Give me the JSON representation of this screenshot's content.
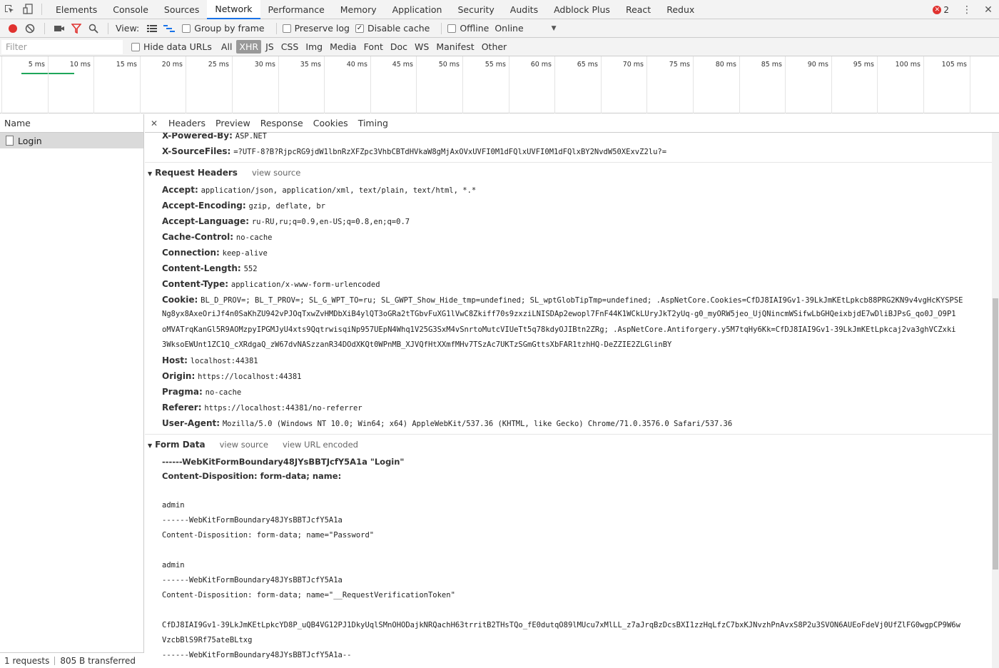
{
  "tabbar": {
    "tabs": [
      "Elements",
      "Console",
      "Sources",
      "Network",
      "Performance",
      "Memory",
      "Application",
      "Security",
      "Audits",
      "Adblock Plus",
      "React",
      "Redux"
    ],
    "active": "Network",
    "error_count": "2"
  },
  "toolbar": {
    "view_label": "View:",
    "group_by_frame": "Group by frame",
    "preserve_log": "Preserve log",
    "disable_cache": "Disable cache",
    "offline": "Offline",
    "throttle_value": "Online"
  },
  "filterbar": {
    "placeholder": "Filter",
    "hide_data_urls": "Hide data URLs",
    "types": [
      "All",
      "XHR",
      "JS",
      "CSS",
      "Img",
      "Media",
      "Font",
      "Doc",
      "WS",
      "Manifest",
      "Other"
    ],
    "active_type": "XHR"
  },
  "timeline": {
    "ticks": [
      "5 ms",
      "10 ms",
      "15 ms",
      "20 ms",
      "25 ms",
      "30 ms",
      "35 ms",
      "40 ms",
      "45 ms",
      "50 ms",
      "55 ms",
      "60 ms",
      "65 ms",
      "70 ms",
      "75 ms",
      "80 ms",
      "85 ms",
      "90 ms",
      "95 ms",
      "100 ms",
      "105 ms",
      "1"
    ]
  },
  "reqlist": {
    "header": "Name",
    "rows": [
      "Login"
    ],
    "status_requests": "1 requests",
    "status_transferred": "805 B transferred"
  },
  "detail": {
    "tabs": [
      "Headers",
      "Preview",
      "Response",
      "Cookies",
      "Timing"
    ],
    "response_tail": [
      {
        "k": "X-Powered-By:",
        "v": "ASP.NET"
      },
      {
        "k": "X-SourceFiles:",
        "v": "=?UTF-8?B?RjpcRG9jdW1lbnRzXFZpc3VhbCBTdHVkaW8gMjAxOVxUVFI0M1dFQlxUVFI0M1dFQlxBY2NvdW50XExvZ2lu?="
      }
    ],
    "request_title": "Request Headers",
    "view_source": "view source",
    "request_headers": [
      {
        "k": "Accept:",
        "v": "application/json, application/xml, text/plain, text/html, *.*"
      },
      {
        "k": "Accept-Encoding:",
        "v": "gzip, deflate, br"
      },
      {
        "k": "Accept-Language:",
        "v": "ru-RU,ru;q=0.9,en-US;q=0.8,en;q=0.7"
      },
      {
        "k": "Cache-Control:",
        "v": "no-cache"
      },
      {
        "k": "Connection:",
        "v": "keep-alive"
      },
      {
        "k": "Content-Length:",
        "v": "552"
      },
      {
        "k": "Content-Type:",
        "v": "application/x-www-form-urlencoded"
      }
    ],
    "cookie_key": "Cookie:",
    "cookie_lines": [
      "BL_D_PROV=; BL_T_PROV=; SL_G_WPT_TO=ru; SL_GWPT_Show_Hide_tmp=undefined; SL_wptGlobTipTmp=undefined; .AspNetCore.Cookies=CfDJ8IAI9Gv1-39LkJmKEtLpkcb88PRG2KN9v4vgHcKYSPSE",
      "Ng8yx8AxeOriJf4n0SaKhZU942vPJOqTxwZvHMDbXiB4ylQT3oGRa2tTGbvFuXG1lVwC8Zkiff70s9zxziLNISDAp2ewopl7FnF44K1WCkLUryJkT2yUq-g0_myORW5jeo_UjQNincmWSifwLbGHQeixbjdE7wDliBJPsG_qo0J_O9P1",
      "oMVATrqKanGl5R9AOMzpyIPGMJyU4xts9QqtrwisqiNp957UEpN4Whq1V25G3SxM4vSnrtoMutcVIUeTt5q78kdyOJIBtn2ZRg; .AspNetCore.Antiforgery.y5M7tqHy6Kk=CfDJ8IAI9Gv1-39LkJmKEtLpkcaj2va3ghVCZxki",
      "3WksoEWUnt1ZC1Q_cXRdgaQ_zW67dvNASzzanR34DOdXKQt0WPnMB_XJVQfHtXXmfMHv7TSzAc7UKTzSGmGttsXbFAR1tzhHQ-DeZZIE2ZLGlinBY"
    ],
    "request_headers_after": [
      {
        "k": "Host:",
        "v": "localhost:44381"
      },
      {
        "k": "Origin:",
        "v": "https://localhost:44381"
      },
      {
        "k": "Pragma:",
        "v": "no-cache"
      },
      {
        "k": "Referer:",
        "v": "https://localhost:44381/no-referrer"
      },
      {
        "k": "User-Agent:",
        "v": "Mozilla/5.0 (Windows NT 10.0; Win64; x64) AppleWebKit/537.36 (KHTML, like Gecko) Chrome/71.0.3576.0 Safari/537.36"
      }
    ],
    "form_title": "Form Data",
    "view_url_encoded": "view URL encoded",
    "form_lines": [
      {
        "bold": true,
        "t": "------WebKitFormBoundary48JYsBBTJcfY5A1a \"Login\""
      },
      {
        "bold": true,
        "t": "Content-Disposition: form-data; name:"
      },
      {
        "bold": false,
        "t": ""
      },
      {
        "bold": false,
        "t": "admin"
      },
      {
        "bold": false,
        "t": "------WebKitFormBoundary48JYsBBTJcfY5A1a"
      },
      {
        "bold": false,
        "t": "Content-Disposition: form-data; name=\"Password\""
      },
      {
        "bold": false,
        "t": ""
      },
      {
        "bold": false,
        "t": "admin"
      },
      {
        "bold": false,
        "t": "------WebKitFormBoundary48JYsBBTJcfY5A1a"
      },
      {
        "bold": false,
        "t": "Content-Disposition: form-data; name=\"__RequestVerificationToken\""
      },
      {
        "bold": false,
        "t": ""
      },
      {
        "bold": false,
        "t": "CfDJ8IAI9Gv1-39LkJmKEtLpkcYD8P_uQB4VG12PJ1DkyUqlSMnOHODajkNRQachH63trritB2THsTQo_fE0dutqO89lMUcu7xMlLL_z7aJrqBzDcsBXI1zzHqLfzC7bxKJNvzhPnAvxS8P2u3SVON6AUEoFdeVj0UfZlFG0wgpCP9W6w"
      },
      {
        "bold": false,
        "t": "VzcbBlS9Rf75ateBLtxg"
      },
      {
        "bold": false,
        "t": "------WebKitFormBoundary48JYsBBTJcfY5A1a--"
      }
    ]
  },
  "colors": {
    "accent": "#1a73e8",
    "record": "#e0322f",
    "timeline_bar": "#1fa65a"
  }
}
